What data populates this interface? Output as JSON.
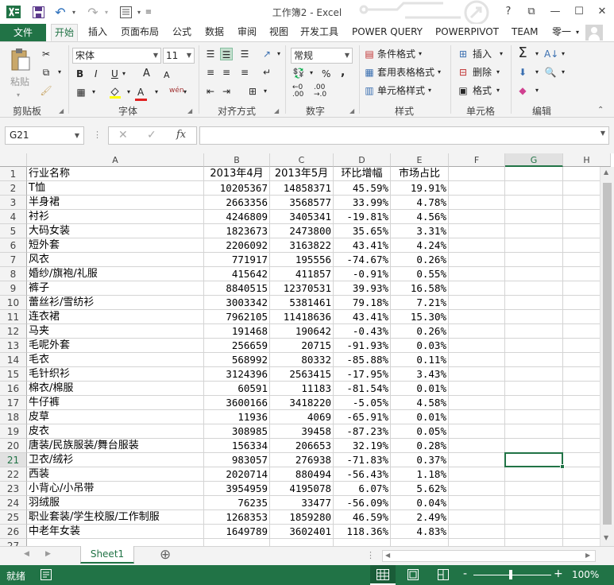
{
  "window": {
    "title": "工作簿2 - Excel",
    "help": "?",
    "controls": {
      "ribbon_display": "⧉",
      "minimize": "—",
      "maximize": "☐",
      "close": "✕"
    }
  },
  "quick_access": {
    "icons": [
      "excel-logo-icon",
      "save-icon",
      "undo-icon",
      "redo-icon",
      "form-icon",
      "customize-icon"
    ]
  },
  "ribbon_tabs": {
    "file": "文件",
    "tabs": [
      "开始",
      "插入",
      "页面布局",
      "公式",
      "数据",
      "审阅",
      "视图",
      "开发工具",
      "POWER QUERY",
      "POWERPIVOT",
      "TEAM",
      "零一"
    ],
    "active": "开始"
  },
  "ribbon": {
    "clipboard": {
      "paste": "粘贴",
      "label": "剪贴板"
    },
    "font": {
      "name": "宋体",
      "size": "11",
      "label": "字体",
      "bold": "B",
      "italic": "I",
      "underline": "U",
      "grow": "A",
      "shrink": "A",
      "font_color": "A",
      "phonetic": "wén"
    },
    "alignment": {
      "label": "对齐方式"
    },
    "number": {
      "format": "常规",
      "label": "数字",
      "percent": "%",
      "comma": ",",
      "inc_decimal": ".0→.00",
      "dec_decimal": ".00→.0"
    },
    "styles": {
      "conditional": "条件格式",
      "table": "套用表格格式",
      "cell": "单元格样式",
      "label": "样式"
    },
    "cells": {
      "insert": "插入",
      "delete": "删除",
      "format": "格式",
      "label": "单元格"
    },
    "editing": {
      "label": "编辑"
    }
  },
  "formula_bar": {
    "name_box": "G21",
    "fx": "fx",
    "cancel": "✕",
    "confirm": "✓",
    "value": ""
  },
  "columns": [
    "A",
    "B",
    "C",
    "D",
    "E",
    "F",
    "G",
    "H"
  ],
  "selected_column": "G",
  "selected_row": "21",
  "rows": [
    {
      "n": "1",
      "a": "行业名称",
      "b": "2013年4月",
      "c": "2013年5月",
      "d": "环比增幅",
      "e": "市场占比"
    },
    {
      "n": "2",
      "a": "T恤",
      "b": "10205367",
      "c": "14858371",
      "d": "45.59%",
      "e": "19.91%"
    },
    {
      "n": "3",
      "a": "半身裙",
      "b": "2663356",
      "c": "3568577",
      "d": "33.99%",
      "e": "4.78%"
    },
    {
      "n": "4",
      "a": "衬衫",
      "b": "4246809",
      "c": "3405341",
      "d": "-19.81%",
      "e": "4.56%"
    },
    {
      "n": "5",
      "a": "大码女装",
      "b": "1823673",
      "c": "2473800",
      "d": "35.65%",
      "e": "3.31%"
    },
    {
      "n": "6",
      "a": "短外套",
      "b": "2206092",
      "c": "3163822",
      "d": "43.41%",
      "e": "4.24%"
    },
    {
      "n": "7",
      "a": "风衣",
      "b": "771917",
      "c": "195556",
      "d": "-74.67%",
      "e": "0.26%"
    },
    {
      "n": "8",
      "a": "婚纱/旗袍/礼服",
      "b": "415642",
      "c": "411857",
      "d": "-0.91%",
      "e": "0.55%"
    },
    {
      "n": "9",
      "a": "裤子",
      "b": "8840515",
      "c": "12370531",
      "d": "39.93%",
      "e": "16.58%"
    },
    {
      "n": "10",
      "a": "蕾丝衫/雪纺衫",
      "b": "3003342",
      "c": "5381461",
      "d": "79.18%",
      "e": "7.21%"
    },
    {
      "n": "11",
      "a": "连衣裙",
      "b": "7962105",
      "c": "11418636",
      "d": "43.41%",
      "e": "15.30%"
    },
    {
      "n": "12",
      "a": "马夹",
      "b": "191468",
      "c": "190642",
      "d": "-0.43%",
      "e": "0.26%"
    },
    {
      "n": "13",
      "a": "毛呢外套",
      "b": "256659",
      "c": "20715",
      "d": "-91.93%",
      "e": "0.03%"
    },
    {
      "n": "14",
      "a": "毛衣",
      "b": "568992",
      "c": "80332",
      "d": "-85.88%",
      "e": "0.11%"
    },
    {
      "n": "15",
      "a": "毛针织衫",
      "b": "3124396",
      "c": "2563415",
      "d": "-17.95%",
      "e": "3.43%"
    },
    {
      "n": "16",
      "a": "棉衣/棉服",
      "b": "60591",
      "c": "11183",
      "d": "-81.54%",
      "e": "0.01%"
    },
    {
      "n": "17",
      "a": "牛仔裤",
      "b": "3600166",
      "c": "3418220",
      "d": "-5.05%",
      "e": "4.58%"
    },
    {
      "n": "18",
      "a": "皮草",
      "b": "11936",
      "c": "4069",
      "d": "-65.91%",
      "e": "0.01%"
    },
    {
      "n": "19",
      "a": "皮衣",
      "b": "308985",
      "c": "39458",
      "d": "-87.23%",
      "e": "0.05%"
    },
    {
      "n": "20",
      "a": "唐装/民族服装/舞台服装",
      "b": "156334",
      "c": "206653",
      "d": "32.19%",
      "e": "0.28%"
    },
    {
      "n": "21",
      "a": "卫衣/绒衫",
      "b": "983057",
      "c": "276938",
      "d": "-71.83%",
      "e": "0.37%"
    },
    {
      "n": "22",
      "a": "西装",
      "b": "2020714",
      "c": "880494",
      "d": "-56.43%",
      "e": "1.18%"
    },
    {
      "n": "23",
      "a": "小背心/小吊带",
      "b": "3954959",
      "c": "4195078",
      "d": "6.07%",
      "e": "5.62%"
    },
    {
      "n": "24",
      "a": "羽绒服",
      "b": "76235",
      "c": "33477",
      "d": "-56.09%",
      "e": "0.04%"
    },
    {
      "n": "25",
      "a": "职业套装/学生校服/工作制服",
      "b": "1268353",
      "c": "1859280",
      "d": "46.59%",
      "e": "2.49%"
    },
    {
      "n": "26",
      "a": "中老年女装",
      "b": "1649789",
      "c": "3602401",
      "d": "118.36%",
      "e": "4.83%"
    },
    {
      "n": "27",
      "a": "",
      "b": "",
      "c": "",
      "d": "",
      "e": ""
    }
  ],
  "sheets": {
    "active": "Sheet1",
    "add": "⊕"
  },
  "status": {
    "ready": "就绪",
    "zoom": "100%",
    "zoom_minus": "-",
    "zoom_plus": "+"
  },
  "colors": {
    "accent": "#217346",
    "ribbon_bg": "#f3f3f3",
    "grid_line": "#d4d4d4"
  }
}
